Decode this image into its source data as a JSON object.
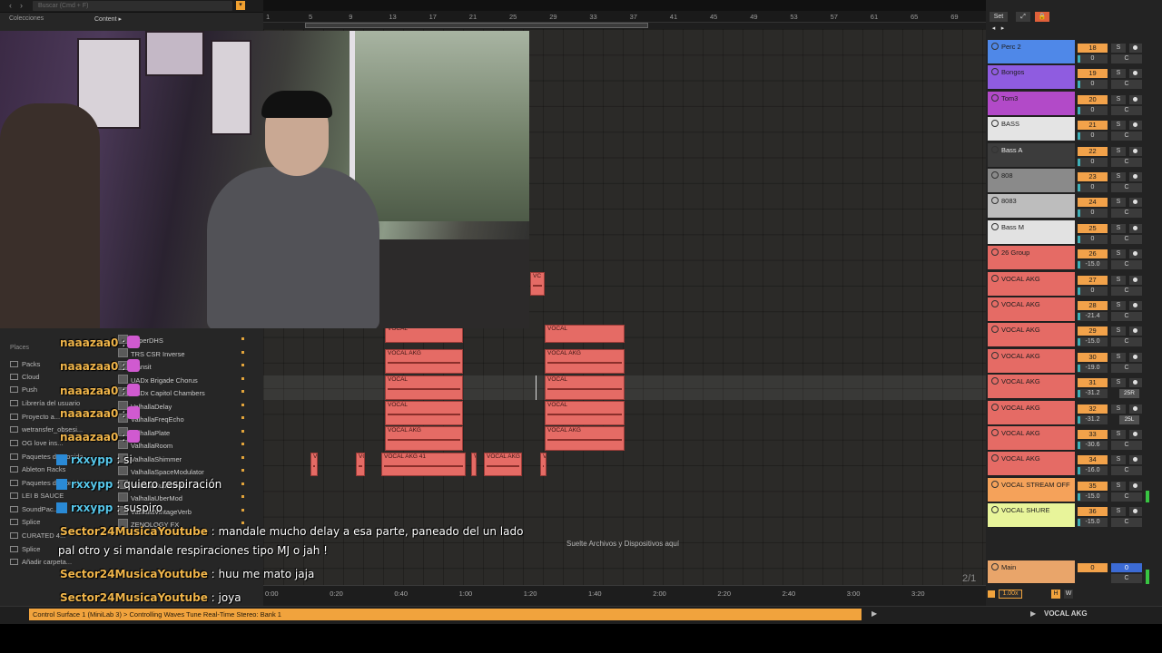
{
  "browser": {
    "search_placeholder": "Buscar (Cmd + F)",
    "collections_label": "Colecciones",
    "content_label": "Content ▸",
    "places_heading": "Places",
    "places": [
      "Packs",
      "Cloud",
      "Push",
      "Librería del usuario",
      "Proyecto a...",
      "wetransfer_obsesi...",
      "OG love ins...",
      "Paquetes de Sonido...",
      "Ableton Racks",
      "Paquetes de sonido...",
      "LEI B SAUCE",
      "SoundPac...",
      "Splice",
      "CURATED 4...",
      "Splice",
      "Añadir carpeta..."
    ],
    "files": [
      "SuperDHS",
      "TRS CSR Inverse",
      "Transit",
      "UADx Brigade Chorus",
      "UADx Capitol Chambers",
      "ValhallaDelay",
      "ValhallaFreqEcho",
      "ValhallaPlate",
      "ValhallaRoom",
      "ValhallaShimmer",
      "ValhallaSpaceModulator",
      "ValhallaSuperVerb",
      "ValhallaUberMod",
      "ValhallaVintageVerb",
      "ZENOLOGY FX"
    ]
  },
  "arrangement": {
    "bar_numbers": [
      "1",
      "5",
      "9",
      "13",
      "17",
      "21",
      "25",
      "29",
      "33",
      "37",
      "41",
      "45",
      "49",
      "53",
      "57",
      "61",
      "65",
      "69"
    ],
    "time_labels": [
      "0:00",
      "0:20",
      "0:40",
      "1:00",
      "1:20",
      "1:40",
      "2:00",
      "2:20",
      "2:40",
      "3:00",
      "3:20"
    ],
    "drop_hint": "Suelte Archivos y Dispositivos aquí",
    "page_indicator": "2/1",
    "clip_label_short": "VOCAL",
    "clip_label_akg": "VOCAL AKG",
    "clip_label_akg41": "VOCAL AKG 41",
    "clip_label_mini": "VC"
  },
  "header": {
    "set_label": "Set"
  },
  "tracks": [
    {
      "name": "Perc 2",
      "num": "18",
      "vol": "0",
      "pan": "C",
      "color": "#4f88e8"
    },
    {
      "name": "Bongos",
      "num": "19",
      "vol": "0",
      "pan": "C",
      "color": "#8f5ce0"
    },
    {
      "name": "Tom3",
      "num": "20",
      "vol": "0",
      "pan": "C",
      "color": "#b24ac8"
    },
    {
      "name": "BASS",
      "num": "21",
      "vol": "0",
      "pan": "C",
      "color": "#e4e4e4"
    },
    {
      "name": "Bass A",
      "num": "22",
      "vol": "0",
      "pan": "C",
      "color": "#3c3c3c"
    },
    {
      "name": "808",
      "num": "23",
      "vol": "0",
      "pan": "C",
      "color": "#8a8a8a"
    },
    {
      "name": "8083",
      "num": "24",
      "vol": "0",
      "pan": "C",
      "color": "#bdbdbd"
    },
    {
      "name": "Bass M",
      "num": "25",
      "vol": "0",
      "pan": "C",
      "color": "#e2e2e2"
    },
    {
      "name": "26 Group",
      "num": "26",
      "vol": "-15.0",
      "pan": "C",
      "color": "#e56b65"
    },
    {
      "name": "VOCAL AKG",
      "num": "27",
      "vol": "0",
      "pan": "C",
      "color": "#e56b65"
    },
    {
      "name": "VOCAL AKG",
      "num": "28",
      "vol": "-21.4",
      "pan": "C",
      "color": "#e56b65"
    },
    {
      "name": "VOCAL AKG",
      "num": "29",
      "vol": "-15.0",
      "pan": "C",
      "color": "#e56b65"
    },
    {
      "name": "VOCAL AKG",
      "num": "30",
      "vol": "-19.0",
      "pan": "C",
      "color": "#e56b65"
    },
    {
      "name": "VOCAL AKG",
      "num": "31",
      "vol": "-31.2",
      "pan": "25R",
      "color": "#e56b65"
    },
    {
      "name": "VOCAL AKG",
      "num": "32",
      "vol": "-31.2",
      "pan": "25L",
      "color": "#e56b65"
    },
    {
      "name": "VOCAL AKG",
      "num": "33",
      "vol": "-30.6",
      "pan": "C",
      "color": "#e56b65"
    },
    {
      "name": "VOCAL AKG",
      "num": "34",
      "vol": "-16.0",
      "pan": "C",
      "color": "#e56b65"
    },
    {
      "name": "VOCAL STREAM OFF",
      "num": "35",
      "vol": "-15.0",
      "pan": "C",
      "color": "#f5a25a"
    },
    {
      "name": "VOCAL SHURE",
      "num": "36",
      "vol": "-15.0",
      "pan": "C",
      "color": "#e8f49a"
    }
  ],
  "main_track": {
    "name": "Main",
    "num": "0",
    "send": "0",
    "pan": "C",
    "color": "#e9a56a"
  },
  "footer": {
    "zoom": "1.00x",
    "h_label": "H",
    "w_label": "W",
    "status_message": "Control Surface 1 (MiniLab 3) > Controlling Waves Tune Real-Time Stereo: Bank 1",
    "selected_track": "VOCAL AKG"
  },
  "chat": [
    {
      "user": "naaazaa0",
      "sep": " :",
      "msg": ""
    },
    {
      "user": "naaazaa0",
      "sep": " :",
      "msg": ""
    },
    {
      "user": "naaazaa0",
      "sep": " :",
      "msg": ""
    },
    {
      "user": "naaazaa0",
      "sep": " :",
      "msg": ""
    },
    {
      "user": "naaazaa0",
      "sep": " :",
      "msg": ""
    },
    {
      "user": "rxxypp",
      "sep": " : ",
      "msg": "si"
    },
    {
      "user": "rxxypp",
      "sep": " : ",
      "msg": "quiero respiración"
    },
    {
      "user": "rxxypp",
      "sep": " : ",
      "msg": "suspiro"
    },
    {
      "user": "Sector24MusicaYoutube",
      "sep": " : ",
      "msg": "mandale mucho delay a esa parte, paneado del un lado"
    },
    {
      "user": "",
      "sep": "",
      "msg": "pal otro y si mandale respiraciones tipo MJ o jah !"
    },
    {
      "user": "Sector24MusicaYoutube",
      "sep": " : ",
      "msg": "huu me mato jaja"
    },
    {
      "user": "Sector24MusicaYoutube",
      "sep": " : ",
      "msg": "joya"
    },
    {
      "user": "Sector24MusicaYoutube",
      "sep": " :",
      "msg": ""
    }
  ],
  "colors": {
    "accent": "#f1a33d",
    "clip": "#e56b65",
    "chat_user": "#f0b54a",
    "chat_user_alt": "#56c6e9"
  }
}
